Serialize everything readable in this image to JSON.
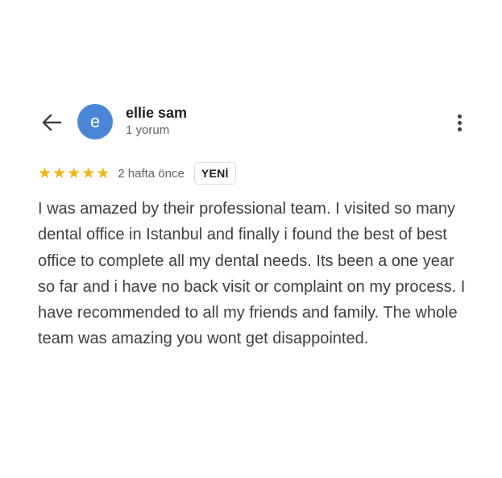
{
  "reviewer": {
    "name": "ellie sam",
    "review_count": "1 yorum",
    "avatar_letter": "e",
    "avatar_color": "#4a86d8"
  },
  "rating": {
    "stars": 5,
    "max_stars": 5,
    "star_color": "#f2b511",
    "date": "2 hafta önce",
    "badge": "YENİ"
  },
  "review": {
    "text": "I was amazed by their professional team. I visited so many dental office in Istanbul and finally i found the best of best office to complete all my dental needs. Its been a one year so far and i have no back visit or complaint on my process. I have recommended to all my friends and family. The whole team was amazing you wont get disappointed."
  },
  "icons": {
    "back": "arrow-left-icon",
    "more": "more-vertical-icon",
    "star": "star-icon"
  }
}
